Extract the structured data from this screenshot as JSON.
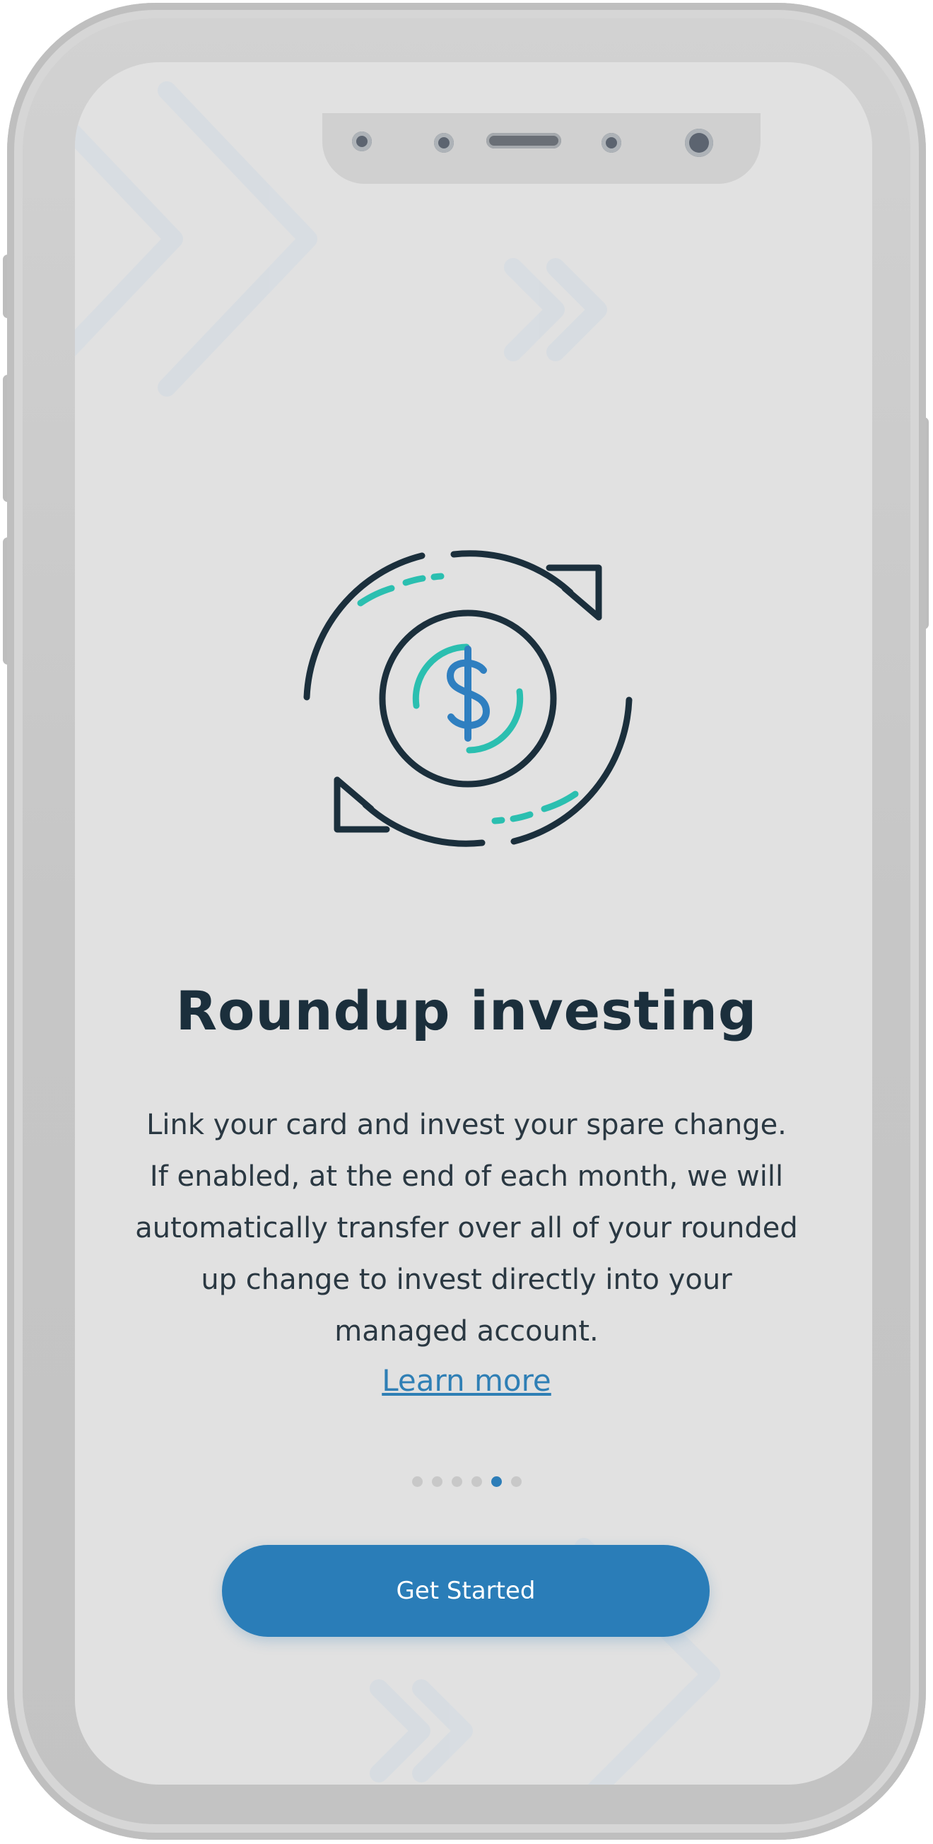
{
  "onboarding": {
    "icon": "roundup-dollar-cycle-icon",
    "title": "Roundup investing",
    "body_lines": [
      "Link your card and invest your spare change.",
      "If enabled, at the end of each month, we will",
      "automatically transfer over all of your rounded",
      "up change to invest directly into your",
      "managed account."
    ],
    "learn_more_label": "Learn more",
    "pager": {
      "total": 6,
      "current": 5
    },
    "cta_label": "Get Started"
  },
  "colors": {
    "background": "#e1e1e1",
    "title": "#1b2f3c",
    "accent_blue": "#2a7db8",
    "accent_teal": "#2bbfb0",
    "icon_dark": "#1b2f3c"
  }
}
